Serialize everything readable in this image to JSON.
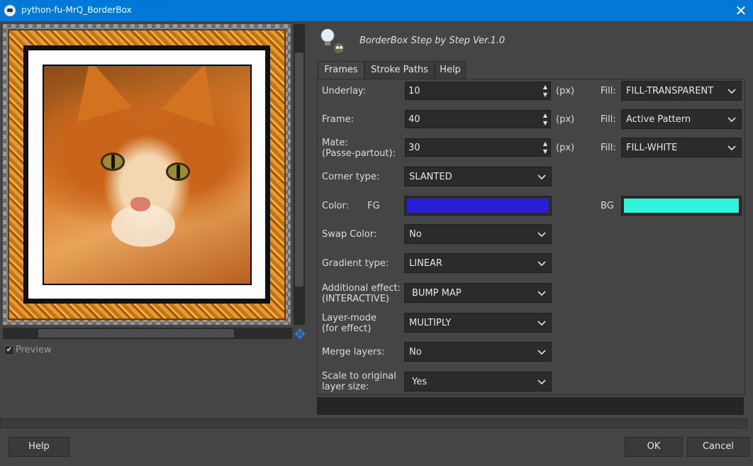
{
  "window": {
    "title": "python-fu-MrQ_BorderBox",
    "close_glyph": "✕"
  },
  "preview": {
    "label": "Preview",
    "checked": true,
    "check_glyph": "✔",
    "nav_glyph": "✥"
  },
  "header": {
    "heading": "BorderBox Step by Step Ver.1.0"
  },
  "tabs": [
    {
      "label": "Frames",
      "active": true
    },
    {
      "label": "Stroke Paths",
      "active": false
    },
    {
      "label": "Help",
      "active": false
    }
  ],
  "unit": "(px)",
  "fill_label": "Fill:",
  "underlay": {
    "label": "Underlay:",
    "value": "10",
    "fill": "FILL-TRANSPARENT"
  },
  "frame": {
    "label": "Frame:",
    "value": "40",
    "fill": "Active Pattern"
  },
  "mate": {
    "label_line1": "Mate:",
    "label_line2": "(Passe-partout):",
    "value": "30",
    "fill": "FILL-WHITE"
  },
  "corner_type": {
    "label": "Corner type:",
    "value": "SLANTED"
  },
  "color": {
    "label": "Color:",
    "fg_label": "FG",
    "bg_label": "BG",
    "fg": "#2a1fd8",
    "bg": "#2ef4dc"
  },
  "swap_color": {
    "label": "Swap Color:",
    "value": "No"
  },
  "gradient_type": {
    "label": "Gradient type:",
    "value": "LINEAR"
  },
  "additional_effect": {
    "label_line1": "Additional effect:",
    "label_line2": "(INTERACTIVE)",
    "value": "BUMP MAP"
  },
  "layer_mode": {
    "label_line1": "Layer-mode",
    "label_line2": "(for effect)",
    "value": "MULTIPLY"
  },
  "merge_layers": {
    "label": "Merge layers:",
    "value": "No"
  },
  "scale": {
    "label_line1": "Scale to original",
    "label_line2": "layer size:",
    "value": "Yes"
  },
  "buttons": {
    "help": "Help",
    "ok": "OK",
    "cancel": "Cancel"
  }
}
